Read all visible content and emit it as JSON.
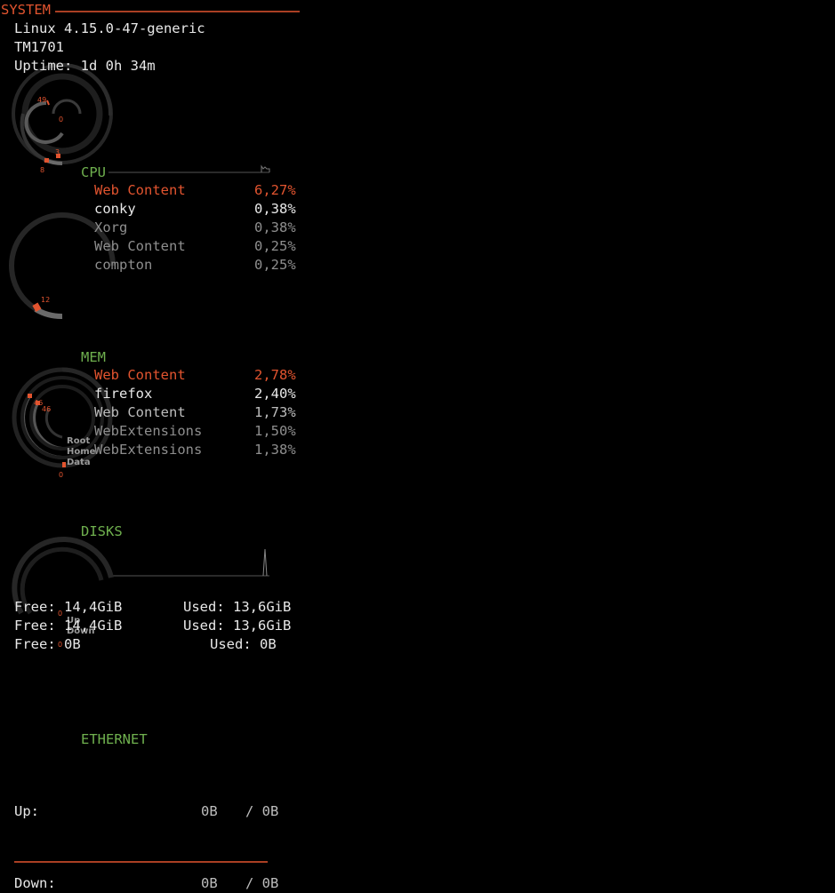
{
  "system": {
    "title": "SYSTEM",
    "kernel": "Linux 4.15.0-47-generic",
    "host": "TM1701",
    "uptime": "Uptime: 1d 0h 34m",
    "gauge_labels": [
      "49",
      "0",
      "3",
      "8"
    ],
    "gauge_levels": [
      0.72,
      0.05,
      0.15,
      0.1
    ]
  },
  "cpu": {
    "title": "CPU",
    "gauge_label": "12",
    "gauge_level": 0.12,
    "processes": [
      {
        "name": "Web Content",
        "value": "6,27%"
      },
      {
        "name": "conky",
        "value": "0,38%"
      },
      {
        "name": "Xorg",
        "value": "0,38%"
      },
      {
        "name": "Web Content",
        "value": "0,25%"
      },
      {
        "name": "compton",
        "value": "0,25%"
      }
    ]
  },
  "mem": {
    "title": "MEM",
    "gauge_labels": [
      "46",
      "46",
      "0"
    ],
    "disk_labels": [
      "Root",
      "Home",
      "Data"
    ],
    "gauge_levels": [
      0.46,
      0.46,
      0.0
    ],
    "processes": [
      {
        "name": "Web Content",
        "value": "2,78%"
      },
      {
        "name": "firefox",
        "value": "2,40%"
      },
      {
        "name": "Web Content",
        "value": "1,73%"
      },
      {
        "name": "WebExtensions",
        "value": "1,50%"
      },
      {
        "name": "WebExtensions",
        "value": "1,38%"
      }
    ]
  },
  "disks": {
    "title": "DISKS",
    "net_labels": [
      "Up",
      "Down"
    ],
    "net_values": [
      "0",
      "0"
    ],
    "rows": [
      {
        "free": "Free: 14,4GiB",
        "used": "Used: 13,6GiB"
      },
      {
        "free": "Free: 14,4GiB",
        "used": "Used: 13,6GiB"
      },
      {
        "free": "Free: 0B",
        "used": "Used: 0B"
      }
    ]
  },
  "ethernet": {
    "title": "ETHERNET",
    "up_label": "Up:",
    "up_value": "0B",
    "up_total": "/ 0B",
    "down_label": "Down:",
    "down_value": "0B",
    "down_total": "/ 0B"
  },
  "colors": {
    "accent": "#e2542f",
    "section": "#6fb04e",
    "ring_bg": "#2a2a2a",
    "ring_fg": "#6a6a6a"
  }
}
